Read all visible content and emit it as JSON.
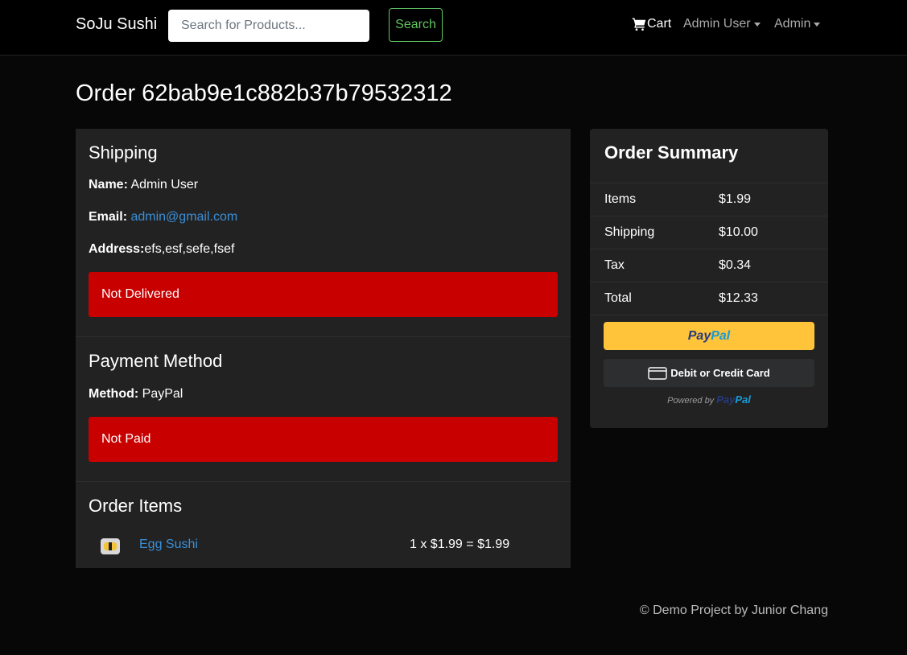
{
  "navbar": {
    "brand": "SoJu Sushi",
    "search_placeholder": "Search for Products...",
    "search_button": "Search",
    "cart_label": "Cart",
    "user_menu": "Admin User",
    "admin_menu": "Admin"
  },
  "page": {
    "title": "Order 62bab9e1c882b37b79532312"
  },
  "shipping": {
    "heading": "Shipping",
    "name_label": "Name:",
    "name_value": "Admin User",
    "email_label": "Email:",
    "email_value": "admin@gmail.com",
    "address_label": "Address:",
    "address_value": "efs,esf,sefe,fsef",
    "status": "Not Delivered"
  },
  "payment": {
    "heading": "Payment Method",
    "method_label": "Method:",
    "method_value": "PayPal",
    "status": "Not Paid"
  },
  "order_items": {
    "heading": "Order Items",
    "items": [
      {
        "name": "Egg Sushi",
        "calc": "1 x $1.99 = $1.99"
      }
    ]
  },
  "summary": {
    "heading": "Order Summary",
    "rows": [
      {
        "label": "Items",
        "value": "$1.99"
      },
      {
        "label": "Shipping",
        "value": "$10.00"
      },
      {
        "label": "Tax",
        "value": "$0.34"
      },
      {
        "label": "Total",
        "value": "$12.33"
      }
    ],
    "paypal_pay": "Pay",
    "paypal_pal": "Pal",
    "card_button": "Debit or Credit Card",
    "powered_by": "Powered by",
    "powered_pay": "Pay",
    "powered_pal": "Pal"
  },
  "footer": {
    "text": "© Demo Project by Junior Chang"
  },
  "colors": {
    "background": "#070707",
    "panel": "#222222",
    "alert_danger": "#c80000",
    "link": "#3a8fd8",
    "search_green": "#62c462",
    "paypal_yellow": "#ffc439"
  }
}
